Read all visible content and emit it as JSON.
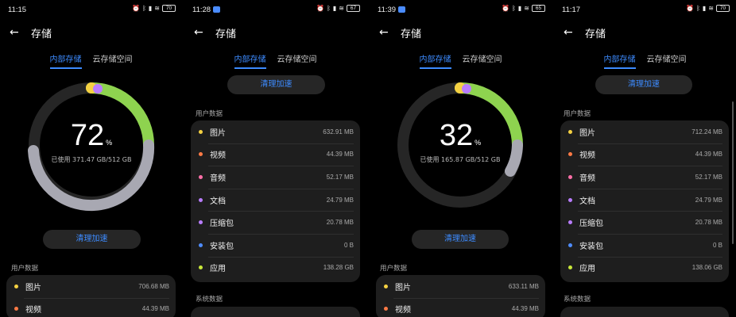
{
  "colors": {
    "accent": "#3d8bff",
    "images": "#f5d142",
    "videos": "#ff7a45",
    "audio": "#ff6fa8",
    "documents": "#b97dff",
    "archives": "#b97dff",
    "apk": "#4f8dff",
    "apps": "#c9e83a",
    "ring_system": "#a8a8b2",
    "ring_apps": "#8ed34f",
    "ring_free": "#262626"
  },
  "screens": [
    {
      "status_time": "11:15",
      "battery": "70",
      "title": "存储",
      "tabs": [
        "内部存储",
        "云存储空间"
      ],
      "has_ring": true,
      "ring": {
        "percent": "72",
        "percent_sign": "%",
        "used_text": "已使用 371.47 GB/512 GB",
        "used_fraction": 0.72
      },
      "clean_button": "清理加速",
      "sections": [
        "用户数据"
      ],
      "items": [
        {
          "icon": "dot-images",
          "label": "图片",
          "size": "706.68 MB",
          "color": "#f5d142"
        },
        {
          "icon": "dot-videos",
          "label": "视频",
          "size": "44.39 MB",
          "color": "#ff7a45"
        }
      ]
    },
    {
      "status_time": "11:28",
      "battery": "67",
      "title": "存储",
      "tabs": [
        "内部存储",
        "云存储空间"
      ],
      "has_ring": false,
      "clean_button": "清理加速",
      "sections": [
        "用户数据",
        "系统数据"
      ],
      "items": [
        {
          "icon": "dot-images",
          "label": "图片",
          "size": "632.91 MB",
          "color": "#f5d142"
        },
        {
          "icon": "dot-videos",
          "label": "视频",
          "size": "44.39 MB",
          "color": "#ff7a45"
        },
        {
          "icon": "dot-audio",
          "label": "音频",
          "size": "52.17 MB",
          "color": "#ff6fa8"
        },
        {
          "icon": "dot-documents",
          "label": "文档",
          "size": "24.79 MB",
          "color": "#b97dff"
        },
        {
          "icon": "dot-archives",
          "label": "压缩包",
          "size": "20.78 MB",
          "color": "#b97dff"
        },
        {
          "icon": "dot-apk",
          "label": "安装包",
          "size": "0 B",
          "color": "#4f8dff"
        },
        {
          "icon": "dot-apps",
          "label": "应用",
          "size": "138.28 GB",
          "color": "#c9e83a"
        }
      ]
    },
    {
      "status_time": "11:39",
      "battery": "65",
      "title": "存储",
      "tabs": [
        "内部存储",
        "云存储空间"
      ],
      "has_ring": true,
      "ring": {
        "percent": "32",
        "percent_sign": "%",
        "used_text": "已使用 165.87 GB/512 GB",
        "used_fraction": 0.32
      },
      "clean_button": "清理加速",
      "sections": [
        "用户数据"
      ],
      "items": [
        {
          "icon": "dot-images",
          "label": "图片",
          "size": "633.11 MB",
          "color": "#f5d142"
        },
        {
          "icon": "dot-videos",
          "label": "视频",
          "size": "44.39 MB",
          "color": "#ff7a45"
        }
      ]
    },
    {
      "status_time": "11:17",
      "battery": "70",
      "title": "存储",
      "tabs": [
        "内部存储",
        "云存储空间"
      ],
      "has_ring": false,
      "clean_button": "清理加速",
      "sections": [
        "用户数据",
        "系统数据"
      ],
      "items": [
        {
          "icon": "dot-images",
          "label": "图片",
          "size": "712.24 MB",
          "color": "#f5d142"
        },
        {
          "icon": "dot-videos",
          "label": "视频",
          "size": "44.39 MB",
          "color": "#ff7a45"
        },
        {
          "icon": "dot-audio",
          "label": "音频",
          "size": "52.17 MB",
          "color": "#ff6fa8"
        },
        {
          "icon": "dot-documents",
          "label": "文档",
          "size": "24.79 MB",
          "color": "#b97dff"
        },
        {
          "icon": "dot-archives",
          "label": "压缩包",
          "size": "20.78 MB",
          "color": "#b97dff"
        },
        {
          "icon": "dot-apk",
          "label": "安装包",
          "size": "0 B",
          "color": "#4f8dff"
        },
        {
          "icon": "dot-apps",
          "label": "应用",
          "size": "138.06 GB",
          "color": "#c9e83a"
        }
      ]
    }
  ]
}
